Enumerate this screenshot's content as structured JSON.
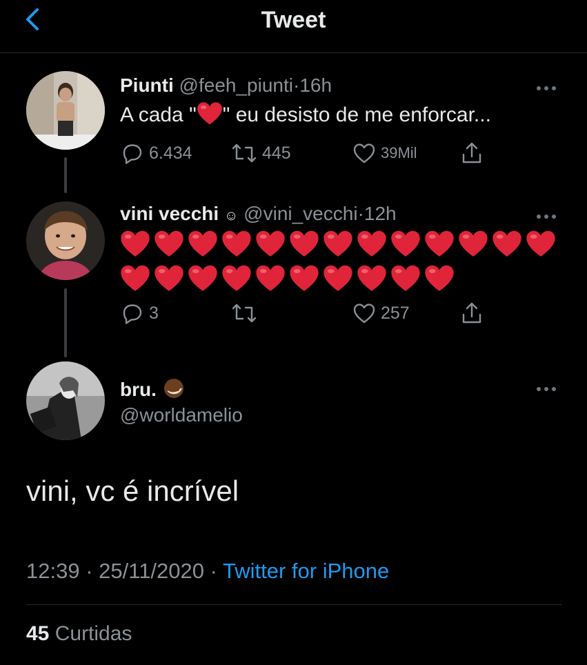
{
  "header": {
    "title": "Tweet",
    "back_icon": "chevron-left-icon",
    "accent": "#1d9bf0"
  },
  "tweets": [
    {
      "name": "Piunti",
      "handle": "@feeh_piunti",
      "separator": "·",
      "time": "16h",
      "text_before": "A cada \"",
      "text_after": "\" eu desisto de me enforcar...",
      "replies": "6.434",
      "retweets": "445",
      "likes": "39Mil"
    },
    {
      "name": "vini vecchi",
      "name_emoji": "☺",
      "handle": "@vini_vecchi",
      "separator": "·",
      "time": "12h",
      "heart_count": 23,
      "replies": "3",
      "retweets": "",
      "likes": "257"
    }
  ],
  "main": {
    "name": "bru.",
    "name_emoji": "coconut-emoji",
    "handle": "@worldamelio",
    "text": "vini, vc é incrível",
    "time": "12:39",
    "separator": "·",
    "date": "25/11/2020",
    "separator2": "·",
    "source": "Twitter for iPhone",
    "likes_count": "45",
    "likes_label": "Curtidas"
  },
  "colors": {
    "background": "#000000",
    "text": "#e7e9ea",
    "muted": "#8b9197",
    "link": "#1d9bf0",
    "heart": "#e0243a"
  }
}
